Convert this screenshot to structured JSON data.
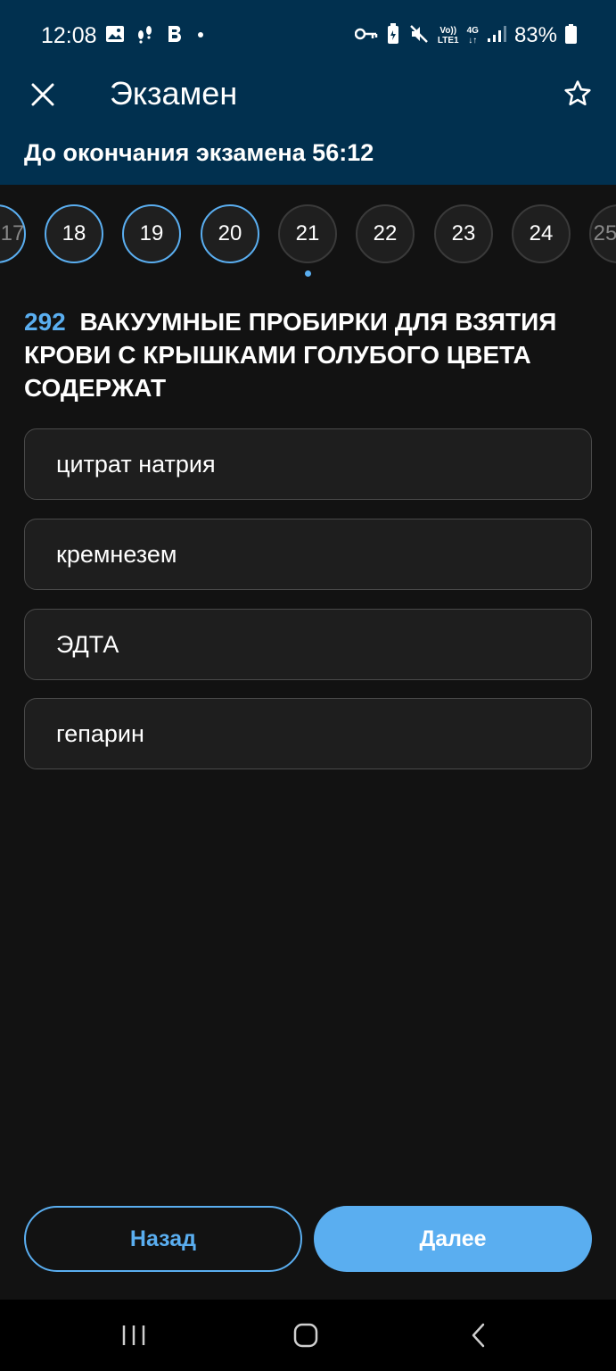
{
  "status_bar": {
    "time": "12:08",
    "left_icons": [
      "image-icon",
      "walk-icon",
      "app-b-icon",
      "dot-icon"
    ],
    "volte_top": "Vo))",
    "volte_bottom": "LTE1",
    "network": "4G",
    "battery": "83%"
  },
  "app_bar": {
    "title": "Экзамен",
    "timer": "До окончания экзамена 56:12"
  },
  "question_nav": {
    "partial_left": "17",
    "items": [
      {
        "label": "18",
        "answered": true
      },
      {
        "label": "19",
        "answered": true
      },
      {
        "label": "20",
        "answered": true
      },
      {
        "label": "21",
        "answered": false,
        "current": true
      },
      {
        "label": "22",
        "answered": false
      },
      {
        "label": "23",
        "answered": false
      },
      {
        "label": "24",
        "answered": false
      }
    ],
    "partial_right": "25"
  },
  "question": {
    "number": "292",
    "text": "ВАКУУМНЫЕ ПРОБИРКИ ДЛЯ ВЗЯТИЯ КРОВИ С КРЫШКАМИ ГОЛУБОГО ЦВЕТА СОДЕРЖАТ"
  },
  "answers": [
    "цитрат натрия",
    "кремнезем",
    "ЭДТА",
    "гепарин"
  ],
  "buttons": {
    "back": "Назад",
    "next": "Далее"
  },
  "colors": {
    "header_bg": "#01304f",
    "accent": "#5aaef0",
    "page_bg": "#121212"
  }
}
